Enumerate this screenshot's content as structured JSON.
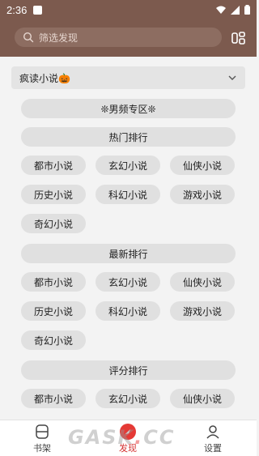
{
  "status_bar": {
    "time": "2:36"
  },
  "app_bar": {
    "search_placeholder": "筛选发现"
  },
  "source_selector": {
    "value": "疯读小说🎃"
  },
  "sections": [
    {
      "title": "❊男频专区❊",
      "kind": "header"
    },
    {
      "title": "热门排行",
      "kind": "group",
      "items": [
        "都市小说",
        "玄幻小说",
        "仙侠小说",
        "历史小说",
        "科幻小说",
        "游戏小说",
        "奇幻小说"
      ]
    },
    {
      "title": "最新排行",
      "kind": "group",
      "items": [
        "都市小说",
        "玄幻小说",
        "仙侠小说",
        "历史小说",
        "科幻小说",
        "游戏小说",
        "奇幻小说"
      ]
    },
    {
      "title": "评分排行",
      "kind": "group",
      "items": [
        "都市小说",
        "玄幻小说",
        "仙侠小说"
      ]
    }
  ],
  "bottom_nav": {
    "items": [
      {
        "label": "书架",
        "icon": "bookshelf-icon"
      },
      {
        "label": "发现",
        "icon": "discover-icon",
        "active": true
      },
      {
        "label": "设置",
        "icon": "person-icon"
      }
    ]
  },
  "watermark": {
    "text_main": "GASK",
    "text_dot": ".",
    "text_tail": "CC"
  },
  "colors": {
    "toolbar": "#7c5a4e",
    "accent": "#e53935",
    "chip": "#e0e0e0"
  }
}
